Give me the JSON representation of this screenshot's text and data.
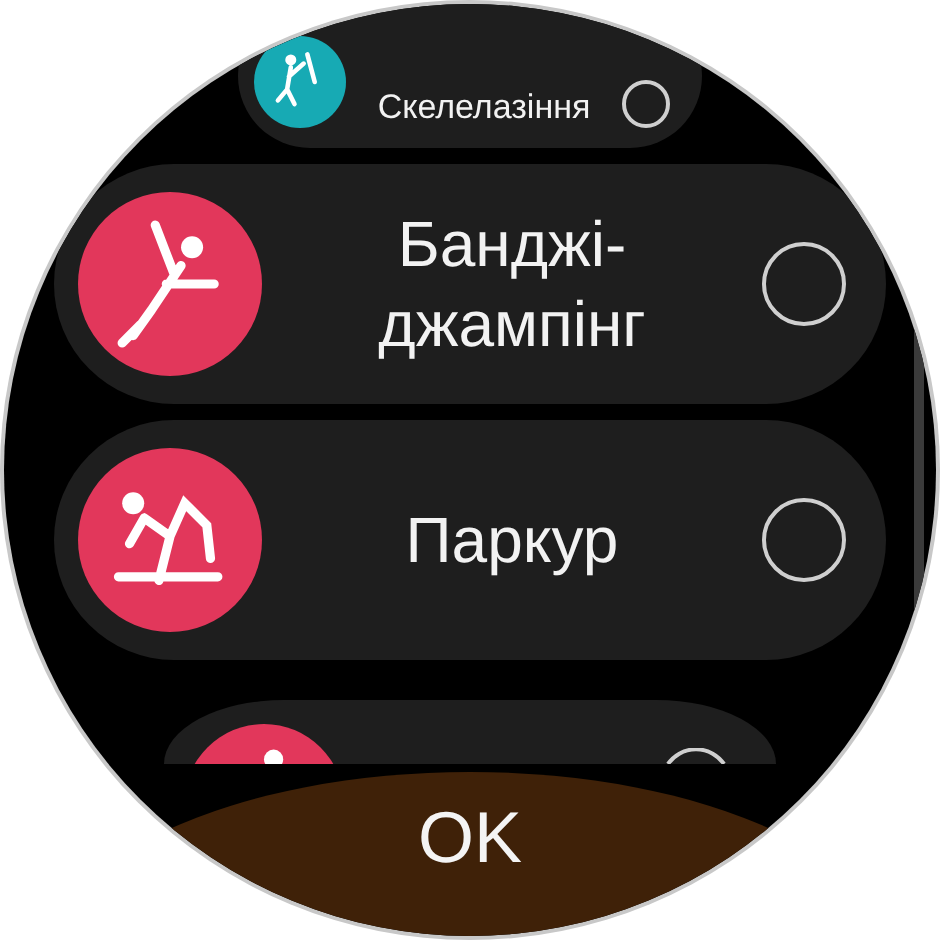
{
  "activities": [
    {
      "label": "Скелелазіння",
      "color": "#17aab4",
      "kind": "climb",
      "selected": false
    },
    {
      "label": "Банджі-джампінг",
      "color": "#e2375b",
      "kind": "jump",
      "selected": false
    },
    {
      "label": "Паркур",
      "color": "#e2375b",
      "kind": "parkour",
      "selected": false
    },
    {
      "color": "#e2375b",
      "kind": "run",
      "selected": false
    }
  ],
  "confirm_button": {
    "label": "OK"
  }
}
